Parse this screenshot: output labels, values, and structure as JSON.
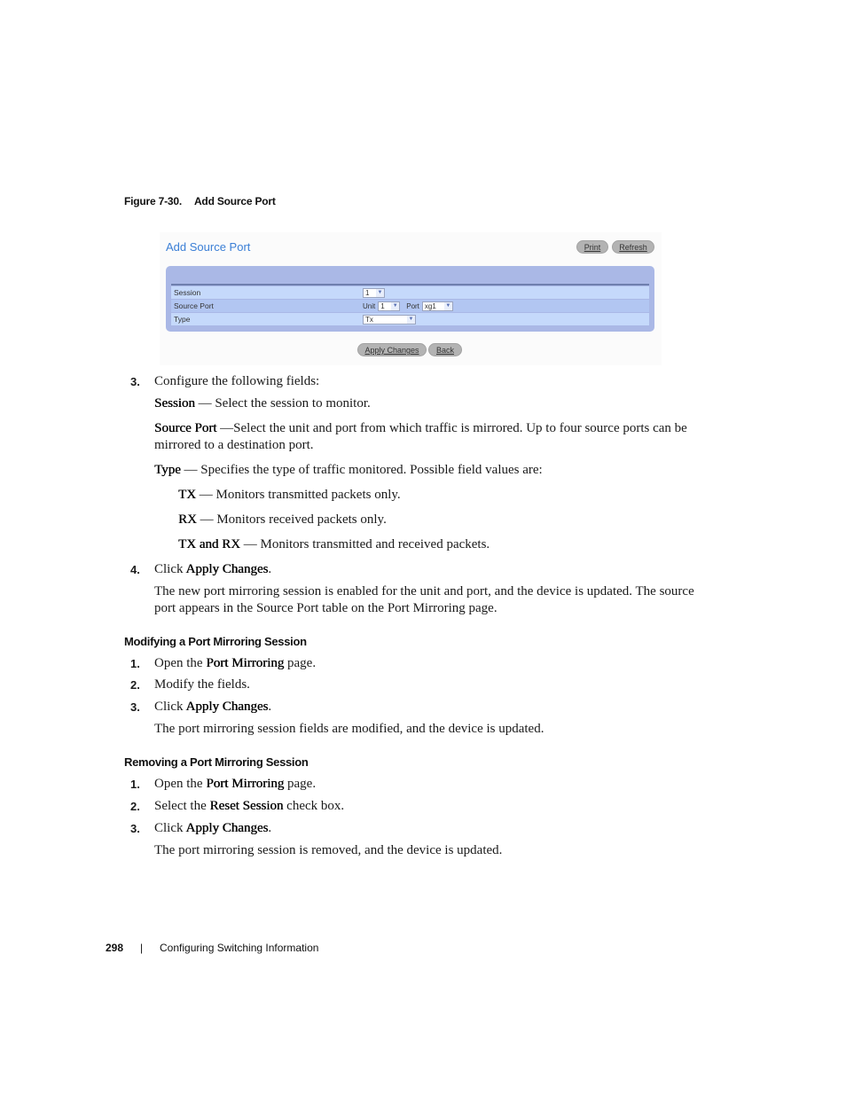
{
  "figure_caption": {
    "number": "Figure 7-30.",
    "title": "Add Source Port"
  },
  "screenshot": {
    "title": "Add Source Port",
    "buttons": {
      "print": "Print",
      "refresh": "Refresh",
      "apply": "Apply Changes",
      "back": "Back"
    },
    "rows": [
      {
        "label": "Session",
        "value": "1"
      },
      {
        "label": "Source Port",
        "unit_label": "Unit",
        "unit_value": "1",
        "port_label": "Port",
        "port_value": "xg1"
      },
      {
        "label": "Type",
        "value": "Tx"
      }
    ],
    "colors": {
      "title": "#3b7fd6",
      "panel": "#aab8e6",
      "row_light": "#c5d9fb",
      "row_dark": "#b2c6f2",
      "button": "#b3b3b3"
    }
  },
  "steps_add": [
    {
      "num": "3.",
      "text": "Configure the following fields:"
    },
    {
      "num": "4.",
      "pre": "Click ",
      "bold": "Apply Changes",
      "post": "."
    }
  ],
  "fields": {
    "session": {
      "term": "Session",
      "desc": " — Select the session to monitor."
    },
    "source_port": {
      "term": "Source Port",
      "desc_line1": " —Select the unit and port from which traffic is mirrored. Up to four source ports can be",
      "desc_line2": "mirrored to a destination port."
    },
    "type": {
      "term": "Type",
      "desc": " — Specifies the type of traffic monitored. Possible field values are:"
    },
    "type_values": [
      {
        "term": "TX",
        "desc": " — Monitors transmitted packets only."
      },
      {
        "term": "RX",
        "desc": " — Monitors received packets only."
      },
      {
        "term": "TX and RX",
        "desc": " — Monitors transmitted and received packets."
      }
    ]
  },
  "result_add": {
    "line1": "The new port mirroring session is enabled for the unit and port, and the device is updated. The source",
    "line2": "port appears in the Source Port table on the Port Mirroring page."
  },
  "modify": {
    "heading": "Modifying a Port Mirroring Session",
    "steps": [
      {
        "num": "1.",
        "pre": "Open the ",
        "bold": "Port Mirroring",
        "post": " page."
      },
      {
        "num": "2.",
        "pre": "Modify the fields.",
        "bold": "",
        "post": ""
      },
      {
        "num": "3.",
        "pre": "Click ",
        "bold": "Apply Changes",
        "post": "."
      }
    ],
    "result": "The port mirroring session fields are modified, and the device is updated."
  },
  "remove": {
    "heading": "Removing a Port Mirroring Session",
    "steps": [
      {
        "num": "1.",
        "pre": "Open the ",
        "bold": "Port Mirroring",
        "post": " page."
      },
      {
        "num": "2.",
        "pre": "Select the ",
        "bold": "Reset Session",
        "post": " check box."
      },
      {
        "num": "3.",
        "pre": "Click ",
        "bold": "Apply Changes",
        "post": "."
      }
    ],
    "result": "The port mirroring session is removed, and the device is updated."
  },
  "footer": {
    "page_number": "298",
    "separator": "|",
    "section": "Configuring Switching Information"
  }
}
